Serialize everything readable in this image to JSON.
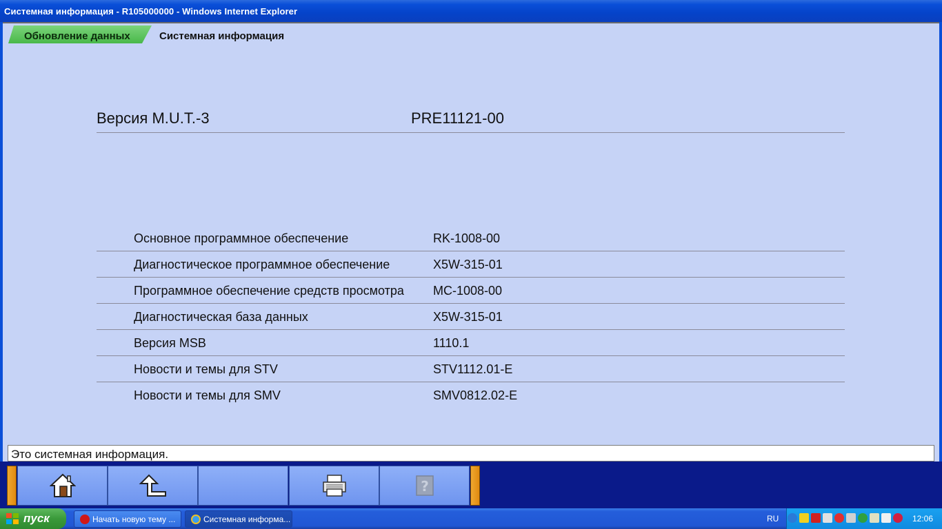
{
  "window": {
    "title": "Системная информация - R105000000 - Windows Internet Explorer"
  },
  "tabs": [
    {
      "label": "Обновление данных"
    },
    {
      "label": "Системная информация"
    }
  ],
  "version": {
    "label": "Версия M.U.T.-3",
    "value": "PRE11121-00"
  },
  "rows": [
    {
      "label": "Основное программное обеспечение",
      "value": "RK-1008-00"
    },
    {
      "label": "Диагностическое программное обеспечение",
      "value": "X5W-315-01"
    },
    {
      "label": "Программное обеспечение средств просмотра",
      "value": "MC-1008-00"
    },
    {
      "label": "Диагностическая база данных",
      "value": "X5W-315-01"
    },
    {
      "label": "Версия MSB",
      "value": "1110.1"
    },
    {
      "label": "Новости и темы для STV",
      "value": "STV1112.01-E"
    },
    {
      "label": "Новости и темы для SMV",
      "value": "SMV0812.02-E"
    }
  ],
  "status": {
    "message": "Это системная информация."
  },
  "toolbar": {
    "buttons": [
      {
        "icon": "home-icon"
      },
      {
        "icon": "back-arrow-icon"
      },
      {
        "icon": ""
      },
      {
        "icon": "printer-icon"
      },
      {
        "icon": "help-icon"
      }
    ]
  },
  "taskbar": {
    "start_label": "пуск",
    "tasks": [
      {
        "label": "Начать новую тему ...",
        "icon": "opera-icon"
      },
      {
        "label": "Системная информа...",
        "icon": "ie-icon"
      }
    ],
    "language": "RU",
    "clock": "12:06"
  },
  "colors": {
    "client_bg": "#c6d3f6",
    "tab_active": "#49b94a",
    "toolbar_bg": "#0a1a8a",
    "toolbar_button": "#7a9ef2",
    "accent_orange": "#f0a830"
  }
}
